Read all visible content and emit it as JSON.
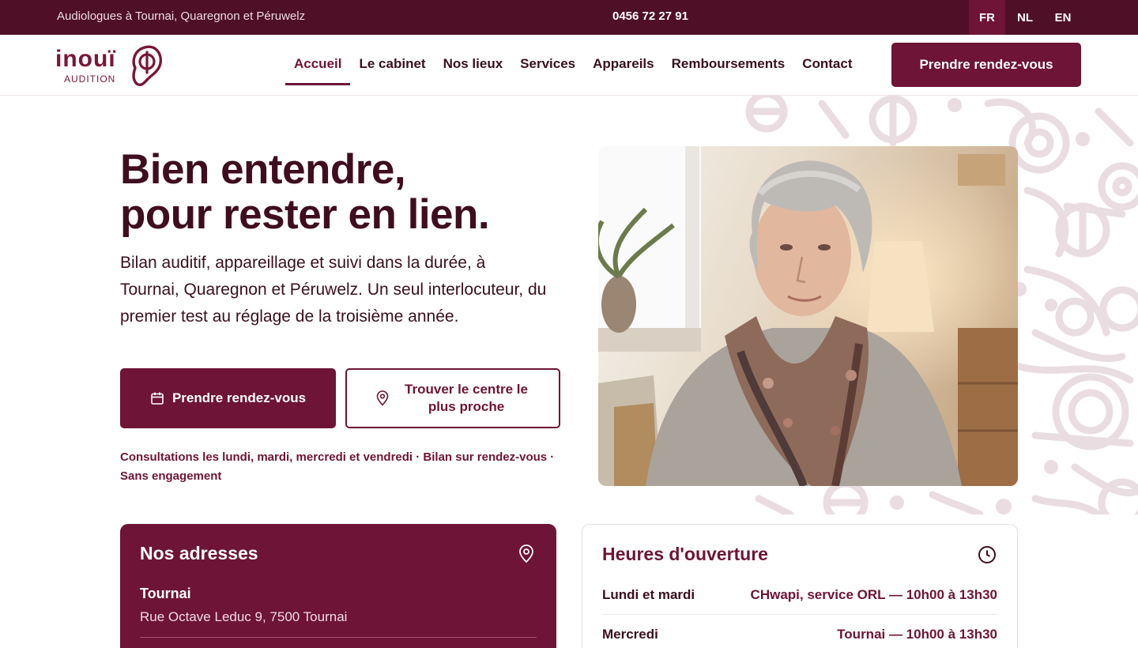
{
  "topbar": {
    "tagline": "Audiologues à Tournai, Quaregnon et Péruwelz",
    "phone": "0456 72 27 91",
    "languages": [
      "FR",
      "NL",
      "EN"
    ],
    "active_language": "FR"
  },
  "brand": {
    "name": "inouï",
    "sub": "AUDITION",
    "color": "#6e1436"
  },
  "nav": {
    "items": [
      "Accueil",
      "Le cabinet",
      "Nos lieux",
      "Services",
      "Appareils",
      "Remboursements",
      "Contact"
    ],
    "active": "Accueil",
    "cta": "Prendre rendez-vous"
  },
  "hero": {
    "title_line1": "Bien entendre,",
    "title_line2": "pour rester en lien.",
    "text": "Bilan auditif, appareillage et suivi dans la durée, à Tournai, Quaregnon et Péruwelz. Un seul interlocuteur, du premier test au réglage de la troisième année.",
    "primary_button": "Prendre rendez-vous",
    "primary_icon": "calendar-icon",
    "secondary_button": "Trouver le centre le plus proche",
    "secondary_icon": "map-pin-icon",
    "consult_note": "Consultations les lundi, mardi, mercredi et vendredi · Bilan sur rendez-vous · Sans engagement"
  },
  "addresses": {
    "title": "Nos adresses",
    "icon": "map-pin-icon",
    "items": [
      {
        "city": "Tournai",
        "street": "Rue Octave Leduc 9, 7500 Tournai"
      }
    ]
  },
  "hours": {
    "title": "Heures d'ouverture",
    "icon": "clock-icon",
    "rows": [
      {
        "day": "Lundi et mardi",
        "time": "CHwapi, service ORL — 10h00 à 13h30"
      },
      {
        "day": "Mercredi",
        "time": "Tournai — 10h00 à 13h30"
      }
    ]
  }
}
